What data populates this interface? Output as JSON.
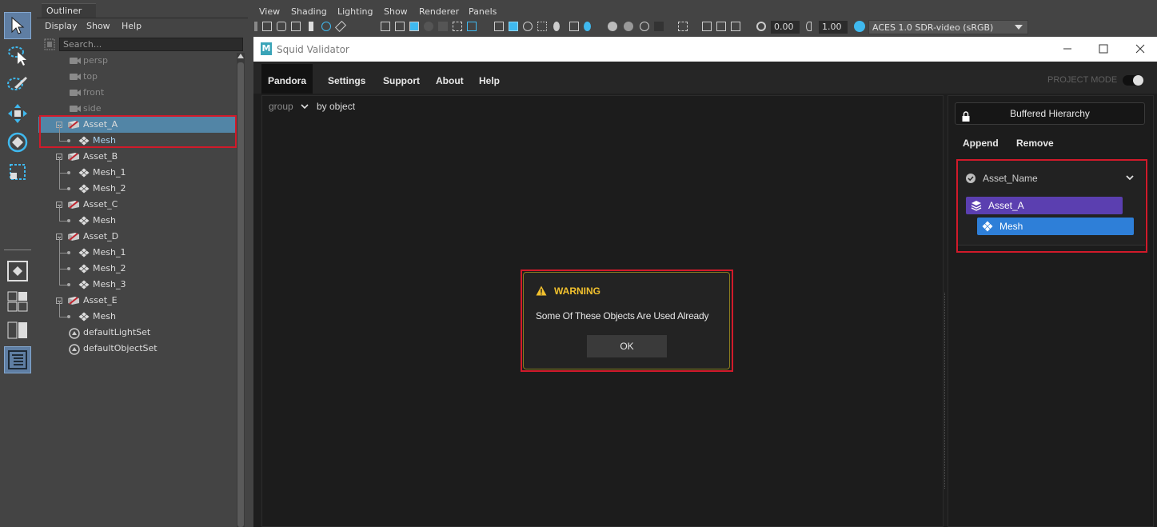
{
  "outliner": {
    "tab_title": "Outliner",
    "menu": [
      "Display",
      "Show",
      "Help"
    ],
    "search_placeholder": "Search...",
    "items": [
      {
        "label": "persp",
        "kind": "camera",
        "dim": true
      },
      {
        "label": "top",
        "kind": "camera",
        "dim": true
      },
      {
        "label": "front",
        "kind": "camera",
        "dim": true
      },
      {
        "label": "side",
        "kind": "camera",
        "dim": true
      },
      {
        "label": "Asset_A",
        "kind": "asset",
        "selected": true
      },
      {
        "label": "Mesh",
        "kind": "mesh"
      },
      {
        "label": "Asset_B",
        "kind": "asset"
      },
      {
        "label": "Mesh_1",
        "kind": "mesh"
      },
      {
        "label": "Mesh_2",
        "kind": "mesh"
      },
      {
        "label": "Asset_C",
        "kind": "asset"
      },
      {
        "label": "Mesh",
        "kind": "mesh"
      },
      {
        "label": "Asset_D",
        "kind": "asset"
      },
      {
        "label": "Mesh_1",
        "kind": "mesh"
      },
      {
        "label": "Mesh_2",
        "kind": "mesh"
      },
      {
        "label": "Mesh_3",
        "kind": "mesh"
      },
      {
        "label": "Asset_E",
        "kind": "asset"
      },
      {
        "label": "Mesh",
        "kind": "mesh"
      },
      {
        "label": "defaultLightSet",
        "kind": "set"
      },
      {
        "label": "defaultObjectSet",
        "kind": "set"
      }
    ]
  },
  "viewport": {
    "menu": [
      "View",
      "Shading",
      "Lighting",
      "Show",
      "Renderer",
      "Panels"
    ],
    "exposure": "0.00",
    "gamma": "1.00",
    "color_space": "ACES 1.0 SDR-video (sRGB)"
  },
  "squid": {
    "title": "Squid Validator",
    "logo_letter": "M",
    "nav": [
      "Pandora",
      "Settings",
      "Support",
      "About",
      "Help"
    ],
    "project_mode": "PROJECT MODE",
    "group_label": "group",
    "group_value": "by object",
    "buffered_hierarchy": "Buffered Hierarchy",
    "append": "Append",
    "remove": "Remove",
    "asset_name": "Asset_Name",
    "pill_asset": "Asset_A",
    "pill_mesh": "Mesh",
    "colors": {
      "asset_pill": "#5b3fb0",
      "mesh_pill": "#2e7fd8",
      "warning": "#f2c12e",
      "highlight": "#d11a2a"
    }
  },
  "warning": {
    "title": "WARNING",
    "message": "Some Of These Objects Are Used Already",
    "ok": "OK"
  }
}
